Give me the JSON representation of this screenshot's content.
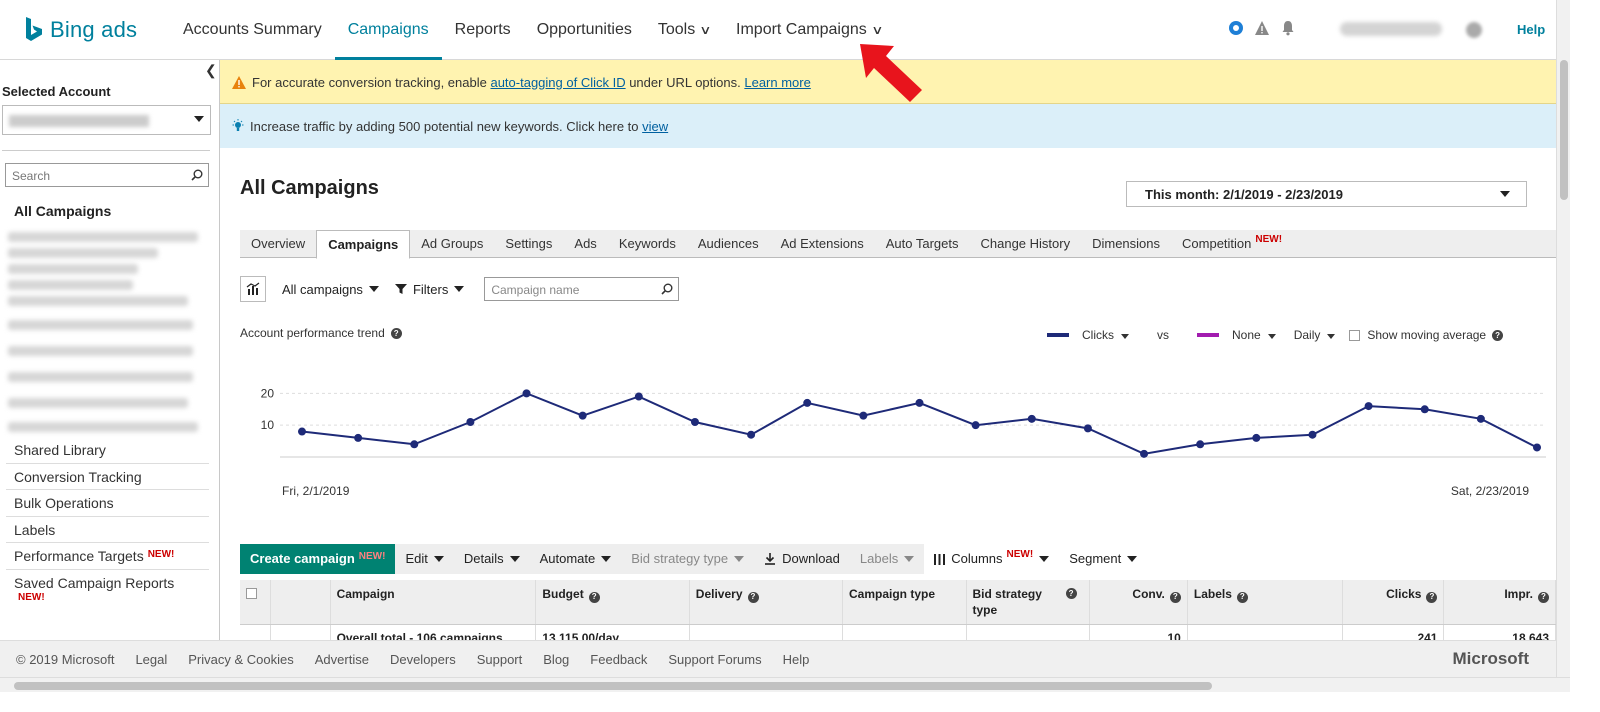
{
  "brand": {
    "logo_text": "Bing ads"
  },
  "nav": {
    "items": [
      {
        "label": "Accounts Summary"
      },
      {
        "label": "Campaigns"
      },
      {
        "label": "Reports"
      },
      {
        "label": "Opportunities"
      },
      {
        "label": "Tools"
      },
      {
        "label": "Import Campaigns"
      }
    ],
    "help": "Help"
  },
  "sidebar": {
    "selected_account_label": "Selected Account",
    "search_placeholder": "Search",
    "all_campaigns": "All Campaigns",
    "links": [
      {
        "label": "Shared Library"
      },
      {
        "label": "Conversion Tracking"
      },
      {
        "label": "Bulk Operations"
      },
      {
        "label": "Labels"
      },
      {
        "label": "Performance Targets",
        "badge": "NEW!"
      },
      {
        "label": "Saved Campaign Reports",
        "badge": "NEW!"
      }
    ]
  },
  "banners": {
    "warning_prefix": "For accurate conversion tracking, enable ",
    "warning_link": "auto-tagging of Click ID",
    "warning_mid": " under URL options. ",
    "warning_learn": "Learn more",
    "tip_prefix": "Increase traffic by adding 500 potential new keywords. Click here to ",
    "tip_link": "view"
  },
  "main": {
    "title": "All Campaigns",
    "date_range": "This month: 2/1/2019 - 2/23/2019",
    "tabs": [
      {
        "label": "Overview"
      },
      {
        "label": "Campaigns"
      },
      {
        "label": "Ad Groups"
      },
      {
        "label": "Settings"
      },
      {
        "label": "Ads"
      },
      {
        "label": "Keywords"
      },
      {
        "label": "Audiences"
      },
      {
        "label": "Ad Extensions"
      },
      {
        "label": "Auto Targets"
      },
      {
        "label": "Change History"
      },
      {
        "label": "Dimensions"
      },
      {
        "label": "Competition",
        "badge": "NEW!"
      }
    ],
    "filter": {
      "scope": "All campaigns",
      "filters": "Filters",
      "search_placeholder": "Campaign name"
    },
    "trend": {
      "title": "Account performance trend",
      "metric1": "Clicks",
      "vs": "vs",
      "metric2": "None",
      "granularity": "Daily",
      "moving_avg": "Show moving average"
    }
  },
  "chart_data": {
    "type": "line",
    "title": "Account performance trend",
    "x": [
      "Fri, 2/1/2019",
      "2/2",
      "2/3",
      "2/4",
      "2/5",
      "2/6",
      "2/7",
      "2/8",
      "2/9",
      "2/10",
      "2/11",
      "2/12",
      "2/13",
      "2/14",
      "2/15",
      "2/16",
      "2/17",
      "2/18",
      "2/19",
      "2/20",
      "2/21",
      "2/22",
      "Sat, 2/23/2019"
    ],
    "x_start_label": "Fri, 2/1/2019",
    "x_end_label": "Sat, 2/23/2019",
    "series": [
      {
        "name": "Clicks",
        "color": "#1e2a78",
        "values": [
          8,
          6,
          4,
          11,
          20,
          13,
          19,
          11,
          7,
          17,
          13,
          17,
          10,
          12,
          9,
          1,
          4,
          6,
          7,
          16,
          15,
          12,
          3
        ]
      }
    ],
    "yticks": [
      10,
      20
    ],
    "ylim": [
      0,
      22
    ],
    "grid": true
  },
  "table_toolbar": {
    "create": "Create campaign",
    "create_badge": "NEW!",
    "edit": "Edit",
    "details": "Details",
    "automate": "Automate",
    "bid_strategy": "Bid strategy type",
    "download": "Download",
    "labels": "Labels",
    "columns": "Columns",
    "columns_badge": "NEW!",
    "segment": "Segment"
  },
  "table": {
    "headers": [
      "Campaign",
      "Budget",
      "Delivery",
      "Campaign type",
      "Bid strategy type",
      "Conv.",
      "Labels",
      "Clicks",
      "Impr."
    ],
    "total_row": {
      "campaign": "Overall total - 106 campaigns",
      "budget": "13,115.00/day",
      "conv": "10",
      "clicks": "241",
      "impr": "18,643"
    }
  },
  "footer": {
    "links": [
      "© 2019 Microsoft",
      "Legal",
      "Privacy & Cookies",
      "Advertise",
      "Developers",
      "Support",
      "Blog",
      "Feedback",
      "Support Forums",
      "Help"
    ],
    "brand": "Microsoft"
  },
  "colors": {
    "accent": "#00809d",
    "create_button": "#008272",
    "warning_banner": "#fff3b0",
    "tip_banner": "#dbeff9",
    "clicks_series": "#1e2a78",
    "none_series": "#a21caf",
    "badge": "#cc0000"
  }
}
